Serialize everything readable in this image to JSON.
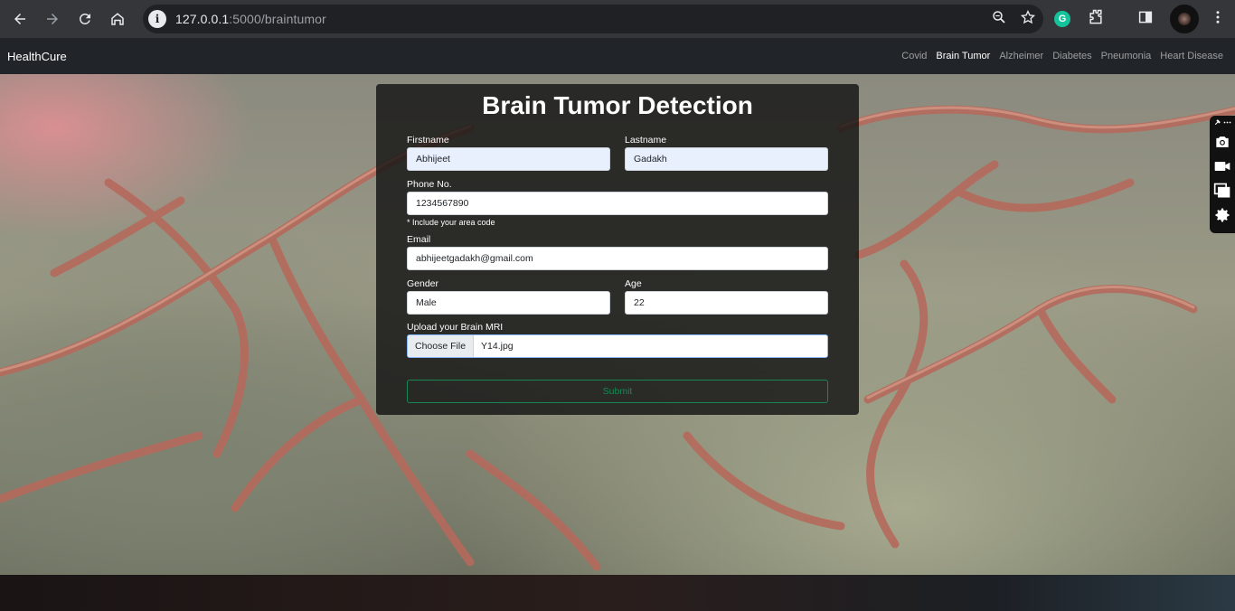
{
  "browser": {
    "url_host": "127.0.0.1",
    "url_path": ":5000/braintumor"
  },
  "navbar": {
    "brand": "HealthCure",
    "links": [
      {
        "label": "Covid",
        "active": false
      },
      {
        "label": "Brain Tumor",
        "active": true
      },
      {
        "label": "Alzheimer",
        "active": false
      },
      {
        "label": "Diabetes",
        "active": false
      },
      {
        "label": "Pneumonia",
        "active": false
      },
      {
        "label": "Heart Disease",
        "active": false
      }
    ]
  },
  "form": {
    "title": "Brain Tumor Detection",
    "firstname": {
      "label": "Firstname",
      "value": "Abhijeet"
    },
    "lastname": {
      "label": "Lastname",
      "value": "Gadakh"
    },
    "phone": {
      "label": "Phone No.",
      "value": "1234567890",
      "help": "* Include your area code"
    },
    "email": {
      "label": "Email",
      "value": "abhijeetgadakh@gmail.com"
    },
    "gender": {
      "label": "Gender",
      "value": "Male"
    },
    "age": {
      "label": "Age",
      "value": "22"
    },
    "upload": {
      "label": "Upload your Brain MRI",
      "button": "Choose File",
      "filename": "Y14.jpg"
    },
    "submit": "Submit"
  },
  "icons": {
    "back": "back-arrow-icon",
    "forward": "forward-arrow-icon",
    "reload": "reload-icon",
    "home": "home-icon",
    "site_info": "info-icon",
    "zoom": "zoom-icon",
    "bookmark": "star-icon",
    "grammarly": "grammarly-icon",
    "extensions": "puzzle-icon",
    "side_panel": "side-panel-icon",
    "menu": "kebab-menu-icon",
    "camera": "camera-icon",
    "video": "video-icon",
    "windows": "windows-icon",
    "settings": "gear-icon"
  },
  "colors": {
    "accent_submit": "#198754",
    "navbar_bg": "#212529",
    "card_bg": "#141414"
  }
}
